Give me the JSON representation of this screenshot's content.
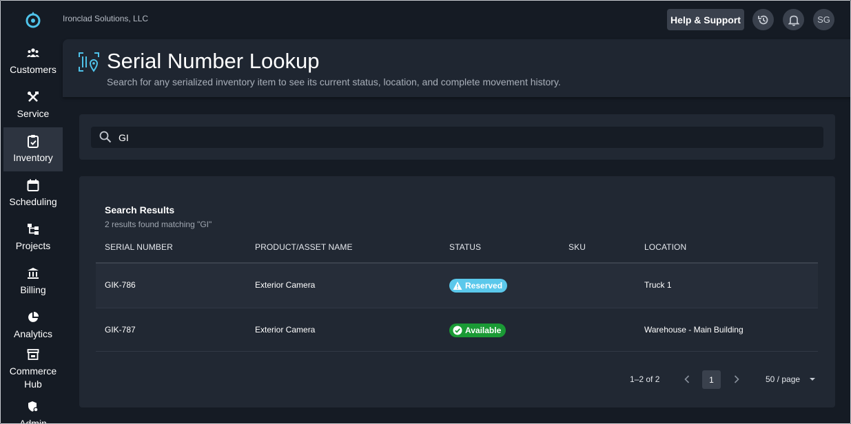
{
  "company_name": "Ironclad Solutions, LLC",
  "topbar": {
    "help_label": "Help & Support",
    "history_icon": "history-icon",
    "notifications_icon": "bell-icon",
    "user_initials": "SG"
  },
  "sidebar": {
    "items": [
      {
        "label": "Customers",
        "icon": "customers-icon"
      },
      {
        "label": "Service",
        "icon": "tools-icon"
      },
      {
        "label": "Inventory",
        "icon": "clipboard-check-icon",
        "active": true
      },
      {
        "label": "Scheduling",
        "icon": "calendar-icon"
      },
      {
        "label": "Projects",
        "icon": "sitemap-icon"
      },
      {
        "label": "Billing",
        "icon": "bank-icon"
      },
      {
        "label": "Analytics",
        "icon": "pie-chart-icon"
      },
      {
        "label": "Commerce Hub",
        "icon": "store-icon"
      },
      {
        "label": "Admin",
        "icon": "admin-shield-icon"
      }
    ]
  },
  "header": {
    "title": "Serial Number Lookup",
    "subtitle": "Search for any serialized inventory item to see its current status, location, and complete movement history."
  },
  "search": {
    "value": "GI"
  },
  "results": {
    "title": "Search Results",
    "count_text": "2 results found matching \"GI\"",
    "columns": [
      "SERIAL NUMBER",
      "PRODUCT/ASSET NAME",
      "STATUS",
      "SKU",
      "LOCATION"
    ],
    "rows": [
      {
        "serial": "GIK-786",
        "product": "Exterior Camera",
        "status": "Reserved",
        "sku": "",
        "location": "Truck 1"
      },
      {
        "serial": "GIK-787",
        "product": "Exterior Camera",
        "status": "Available",
        "sku": "",
        "location": "Warehouse - Main Building"
      }
    ],
    "status_colors": {
      "Reserved": "#5bc8eb",
      "Available": "#1a9a35"
    }
  },
  "pagination": {
    "range": "1–2 of 2",
    "current_page": "1",
    "per_page": "50 / page"
  }
}
